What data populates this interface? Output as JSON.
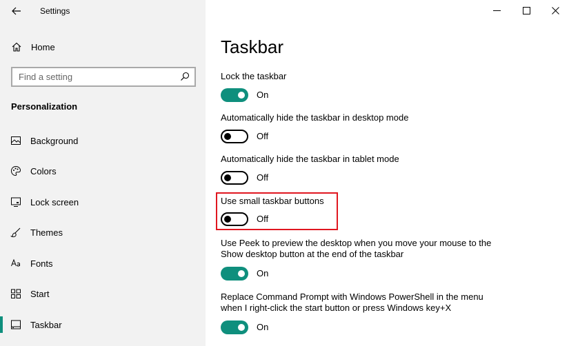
{
  "app": {
    "title": "Settings"
  },
  "sidebar": {
    "home_label": "Home",
    "search": {
      "placeholder": "Find a setting"
    },
    "section": "Personalization",
    "items": [
      {
        "label": "Background",
        "icon": "image-icon"
      },
      {
        "label": "Colors",
        "icon": "palette-icon"
      },
      {
        "label": "Lock screen",
        "icon": "monitor-icon"
      },
      {
        "label": "Themes",
        "icon": "brush-icon"
      },
      {
        "label": "Fonts",
        "icon": "font-icon"
      },
      {
        "label": "Start",
        "icon": "start-grid-icon"
      },
      {
        "label": "Taskbar",
        "icon": "taskbar-icon",
        "active": true
      }
    ]
  },
  "main": {
    "title": "Taskbar",
    "settings": [
      {
        "label": "Lock the taskbar",
        "state": "On",
        "on": true
      },
      {
        "label": "Automatically hide the taskbar in desktop mode",
        "state": "Off",
        "on": false
      },
      {
        "label": "Automatically hide the taskbar in tablet mode",
        "state": "Off",
        "on": false
      },
      {
        "label": "Use small taskbar buttons",
        "state": "Off",
        "on": false
      },
      {
        "label_line1": "Use Peek to preview the desktop when you move your mouse to the",
        "label_line2": "Show desktop button at the end of the taskbar",
        "state": "On",
        "on": true
      },
      {
        "label_line1": "Replace Command Prompt with Windows PowerShell in the menu",
        "label_line2": "when I right-click the start button or press Windows key+X",
        "state": "On",
        "on": true
      }
    ]
  },
  "colors": {
    "accent": "#0f8f7d",
    "highlight": "#e0161f",
    "sidebar_bg": "#f2f2f2"
  }
}
